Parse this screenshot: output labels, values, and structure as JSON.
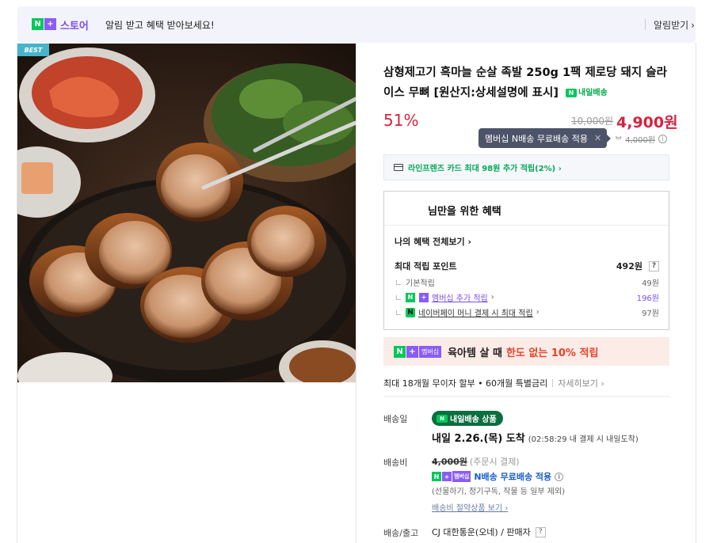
{
  "topbar": {
    "n_letter": "N",
    "plus": "+",
    "store": "스토어",
    "message": "알림 받고 혜택 받아보세요!",
    "alarm_label": "알림받기",
    "alarm_chevron": "›"
  },
  "image": {
    "badge": "BEST",
    "alt_icon": "jokbal-photo"
  },
  "product": {
    "title": "삼형제고기 흑마늘 순살 족발 250g 1팩 제로당 돼지 슬라이스 무뼈 [원산지:상세설명에 표시]",
    "tomorrow_badge": "내일배송",
    "tomorrow_icon_text": "N",
    "discount": "51%",
    "original_price": "10,000원",
    "final_price": "4,900원"
  },
  "tooltip": {
    "text": "멤버십 N배송 무료배송 적용",
    "close": "✕"
  },
  "sub_price": {
    "prefix": "ᄇ",
    "value": "4,000원",
    "info": "i"
  },
  "card_promo": {
    "text": "라인프렌즈 카드 최대 98원 추가 적립(2%) ›"
  },
  "benefit": {
    "title": "님만을 위한 혜택",
    "all_link": "나의 혜택 전체보기 ›",
    "max_points_label": "최대 적립 포인트",
    "max_points_value": "492원",
    "help": "?",
    "basic_label": "기본적립",
    "basic_value": "49원",
    "membership_label": "멤버십 추가 적립",
    "membership_chevron": "›",
    "membership_value": "196원",
    "npay_letter": "N",
    "npay_label": "네이버페이 머니 결제 시 최대 적립",
    "npay_chevron": "›",
    "npay_value": "97원"
  },
  "banner": {
    "membership_tag": "멤버십",
    "text1": "육아템 살 때",
    "text2": "한도 없는 10% 적립"
  },
  "installment": {
    "text": "최대 18개월 무이자 할부 • 60개월 특별금리",
    "more": "자세히보기 ›"
  },
  "shipping": {
    "date_label": "배송일",
    "badge": "내일배송 상품",
    "badge_icon": "N",
    "arrive": "내일 2.26.(목) 도착",
    "arrive_note": "(02:58:29 내 결제 시 내일도착)",
    "fee_label": "배송비",
    "fee_original": "4,000원",
    "fee_note": "(주문시 결제)",
    "membership_tag": "멤버십",
    "free_text": "N배송 무료배송 적용",
    "info": "i",
    "exceptions": "(선물하기, 정기구독, 작물 등 일부 제외)",
    "saving_link": "배송비 절약상품 보기 ›",
    "courier_label": "배송/출고",
    "courier": "CJ 대한통운(오네) / 판매자",
    "courier_help": "?"
  }
}
